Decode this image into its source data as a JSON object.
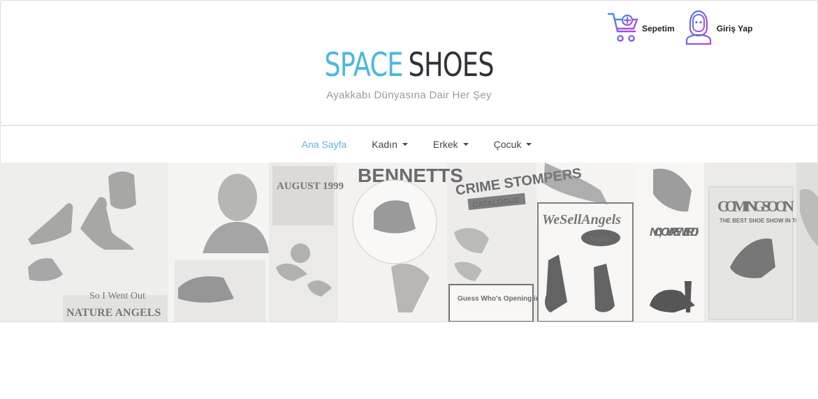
{
  "brand": {
    "name_part1": "SPACE",
    "name_part2": "SHOES",
    "tagline": "Ayakkabı Dünyasına Dair Her Şey"
  },
  "user_area": {
    "cart_label": "Sepetim",
    "cart_icon": "shopping-cart-plus-icon",
    "login_label": "Giriş Yap",
    "login_icon": "astronaut-user-icon"
  },
  "nav": {
    "items": [
      {
        "label": "Ana Sayfa",
        "active": true,
        "dropdown": false
      },
      {
        "label": "Kadın",
        "active": false,
        "dropdown": true
      },
      {
        "label": "Erkek",
        "active": false,
        "dropdown": true
      },
      {
        "label": "Çocuk",
        "active": false,
        "dropdown": true
      }
    ]
  },
  "banner": {
    "posters": [
      "So I Went Out",
      "NATURE ANGELS",
      "AUGUST 1999",
      "BENNETTS",
      "CRIME STOMPERS",
      "CATALOGUE",
      "Guess Who's Opening in Soho This",
      "WeSellAngels",
      "Angels",
      "NO, YOU'RE WEIRD!",
      "COMING SOON",
      "THE BEST SHOE SHOW IN TOWN"
    ]
  },
  "colors": {
    "accent": "#4bb8dd",
    "brand_dark": "#2f3338",
    "icon_purple": "#a33ee0",
    "icon_blue": "#5b6ee8"
  }
}
